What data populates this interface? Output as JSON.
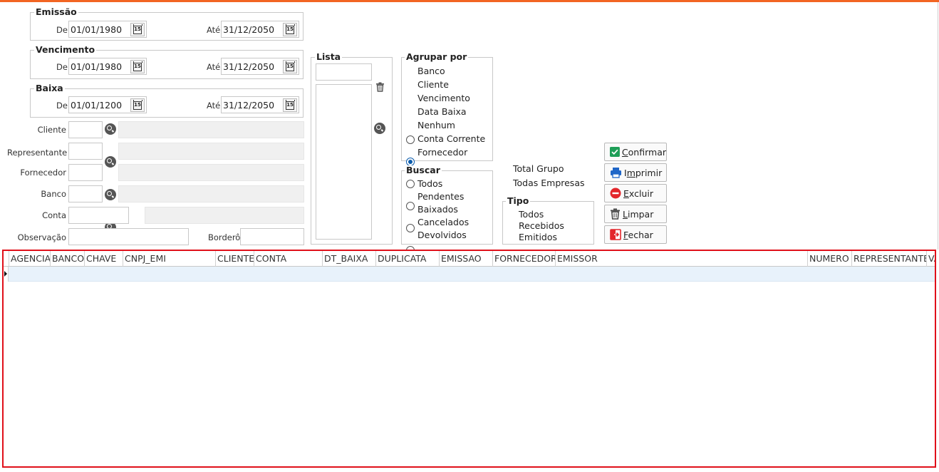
{
  "filters": {
    "emissao": {
      "title": "Emissão",
      "de_label": "De",
      "de": "01/01/1980",
      "ate_label": "Até",
      "ate": "31/12/2050"
    },
    "vencimento": {
      "title": "Vencimento",
      "de_label": "De",
      "de": "01/01/1980",
      "ate_label": "Até",
      "ate": "31/12/2050"
    },
    "baixa": {
      "title": "Baixa",
      "de_label": "De",
      "de": "01/01/1200",
      "ate_label": "Até",
      "ate": "31/12/2050"
    },
    "cliente_label": "Cliente",
    "representante_label": "Representante",
    "fornecedor_label": "Fornecedor",
    "banco_label": "Banco",
    "conta_label": "Conta",
    "observacao_label": "Observação",
    "bordero_label": "Borderô"
  },
  "lista": {
    "title": "Lista"
  },
  "agrupar": {
    "title": "Agrupar por",
    "options": [
      "Banco",
      "Cliente",
      "Vencimento",
      "Data Baixa",
      "Nenhum",
      "Conta Corrente",
      "Fornecedor"
    ],
    "selected": "Cliente"
  },
  "buscar": {
    "title": "Buscar",
    "options": [
      "Todos",
      "Pendentes",
      "Baixados",
      "Cancelados",
      "Devolvidos"
    ],
    "selected": "Pendentes"
  },
  "checks": {
    "total_grupo": "Total Grupo",
    "total_grupo_checked": true,
    "todas_empresas": "Todas Empresas",
    "todas_empresas_checked": false
  },
  "tipo": {
    "title": "Tipo",
    "options": [
      "Todos",
      "Recebidos",
      "Emitidos"
    ],
    "selected": "Todos"
  },
  "buttons": {
    "confirmar_u": "C",
    "confirmar_rest": "onfirmar",
    "imprimir_pre": "I",
    "imprimir_u": "m",
    "imprimir_rest": "primir",
    "excluir_u": "E",
    "excluir_rest": "xcluir",
    "limpar_u": "L",
    "limpar_rest": "impar",
    "fechar_u": "F",
    "fechar_rest": "echar"
  },
  "grid": {
    "columns": [
      "AGENCIA",
      "BANCO",
      "CHAVE",
      "CNPJ_EMI",
      "CLIENTE",
      "CONTA",
      "DT_BAIXA",
      "DUPLICATA",
      "EMISSAO",
      "FORNECEDOR",
      "EMISSOR",
      "NUMERO",
      "REPRESENTANTE",
      "VA"
    ]
  },
  "colors": {
    "accent": "#f26522",
    "highlight_border": "#e0101a",
    "radio_on": "#0b5cad",
    "row_selected": "#e8f2fb"
  }
}
